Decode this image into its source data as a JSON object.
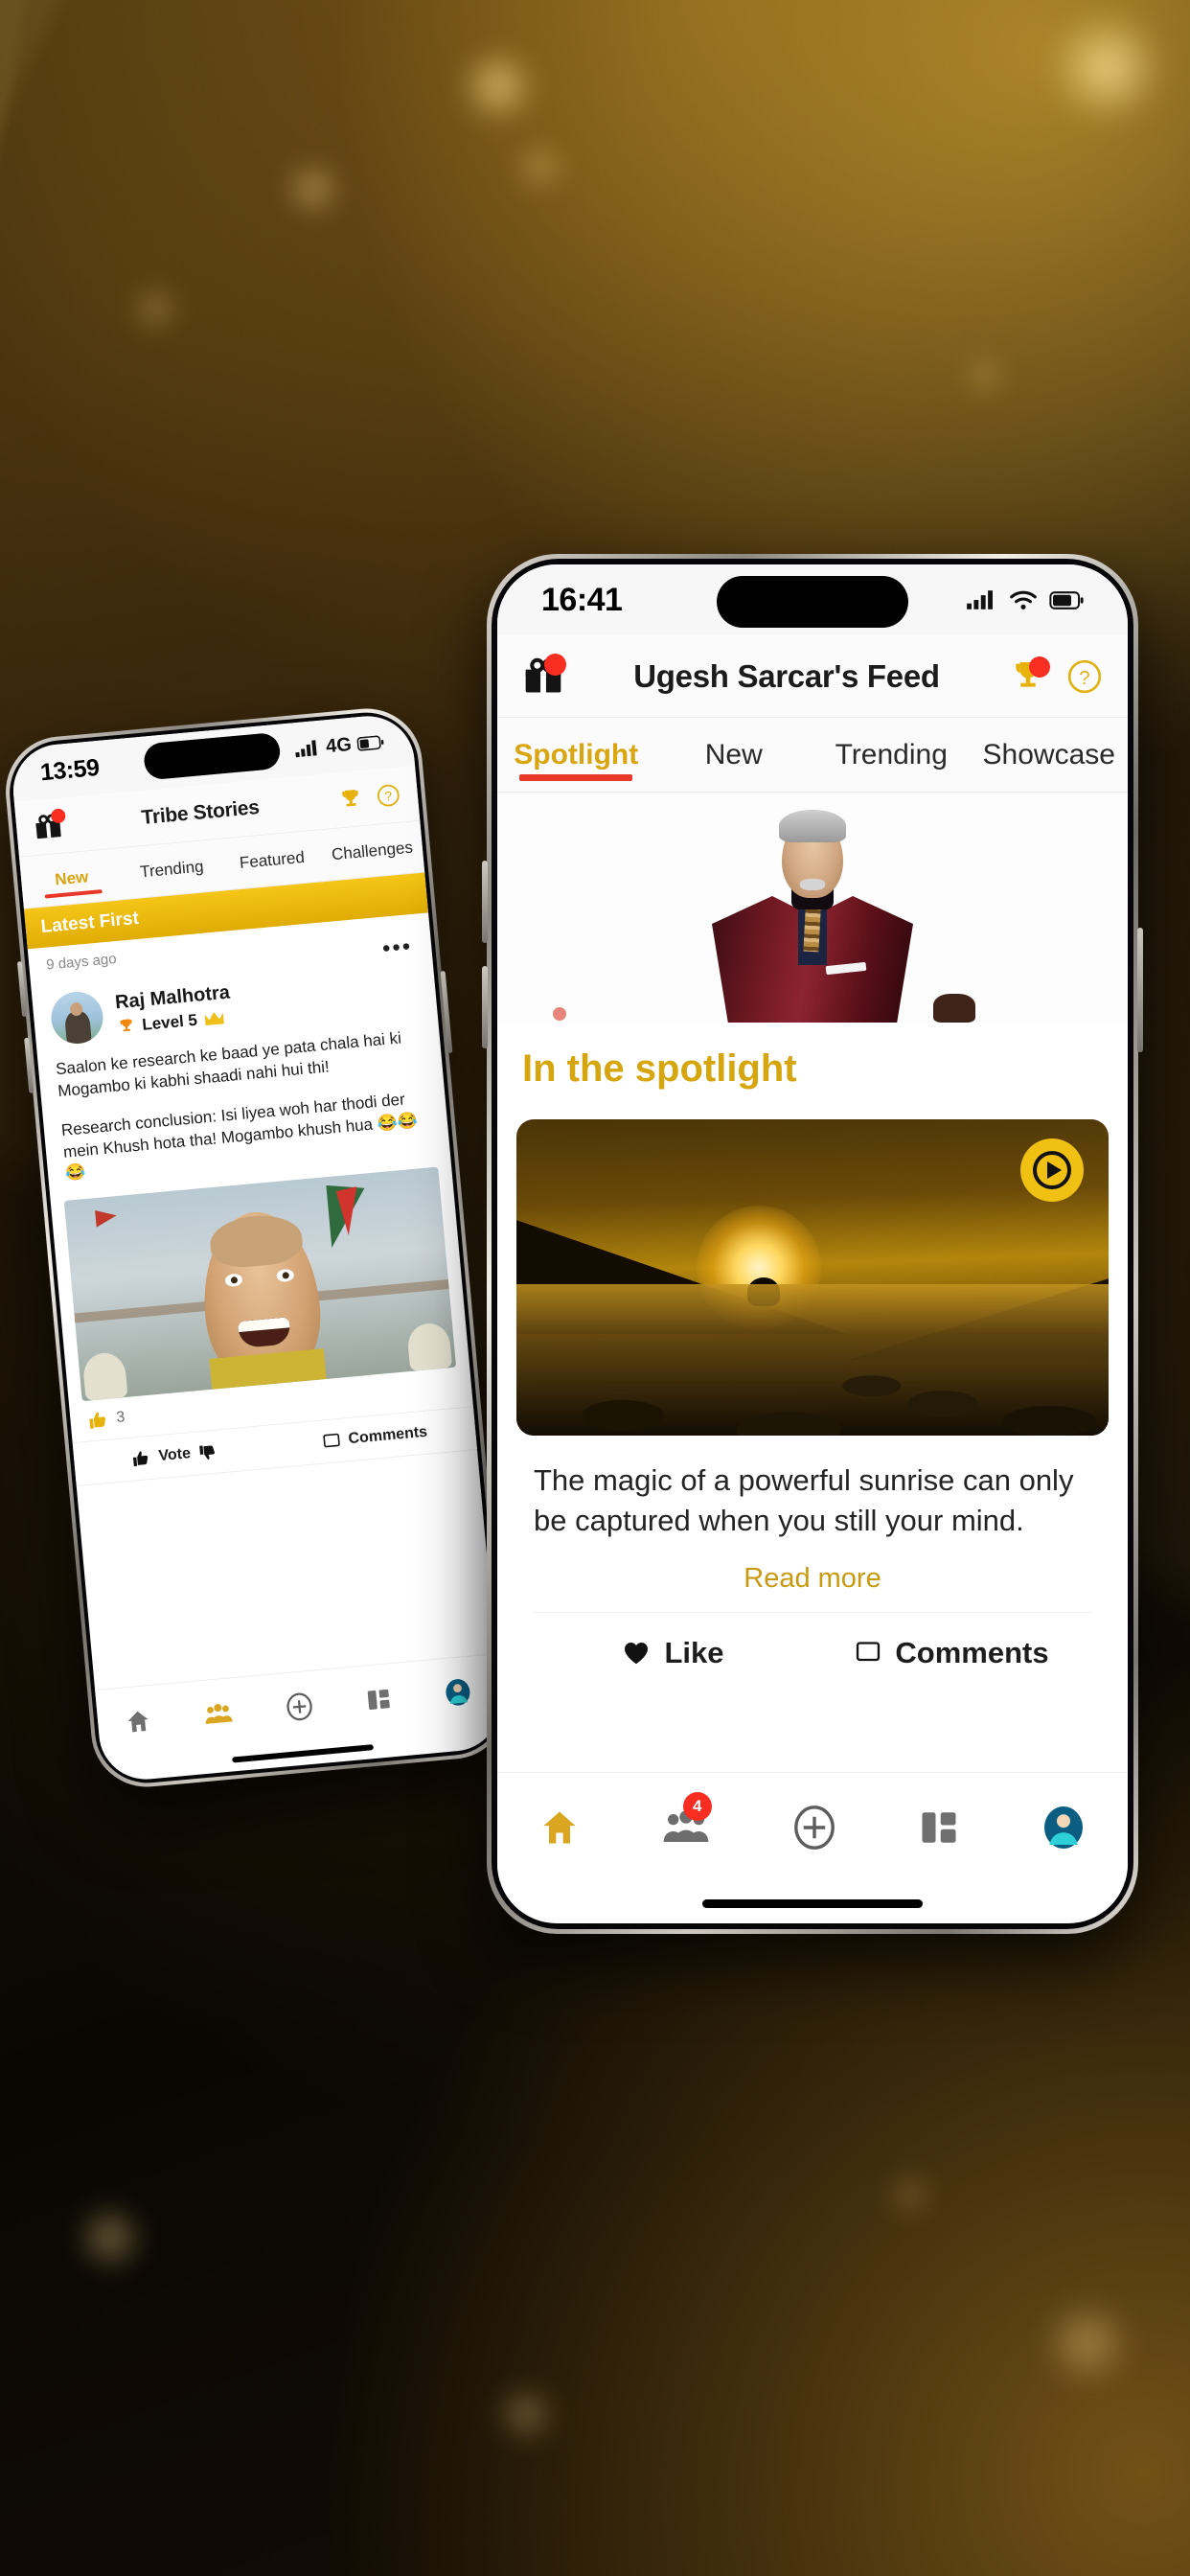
{
  "scene": {
    "description": "Two smartphones displaying a social community app over a dark golden bokeh background",
    "background_colors": [
      "#3a2a0c",
      "#231707",
      "#120c04",
      "#0a0703"
    ],
    "accent_gold": "#d9a510",
    "accent_red": "#e8382a",
    "badge_red": "#fa2d22"
  },
  "right_phone": {
    "status_bar": {
      "time": "16:41",
      "icons": [
        "cellular-signal-icon",
        "wifi-icon",
        "battery-icon"
      ]
    },
    "app_bar": {
      "gift_icon": "gift-icon",
      "gift_badge": "",
      "title": "Ugesh Sarcar's Feed",
      "trophy_icon": "trophy-icon",
      "trophy_badge": "",
      "help_icon": "help-circle-icon"
    },
    "tabs": [
      {
        "label": "Spotlight",
        "active": true
      },
      {
        "label": "New",
        "active": false
      },
      {
        "label": "Trending",
        "active": false
      },
      {
        "label": "Showcase",
        "active": false
      }
    ],
    "spotlight": {
      "hero_alt": "man-in-maroon-bandhgala-portrait",
      "section_title": "In the spotlight"
    },
    "post": {
      "media_alt": "golden-sunset-over-rocky-river",
      "play_icon": "play-circle-icon",
      "text": "The magic of a powerful sunrise can only be captured when you still your mind.",
      "read_more": "Read more",
      "actions": [
        {
          "label": "Like",
          "icon": "heart-icon"
        },
        {
          "label": "Comments",
          "icon": "comment-icon"
        }
      ]
    },
    "bottom_nav": [
      {
        "name": "home",
        "icon": "home-icon",
        "active": true,
        "badge": ""
      },
      {
        "name": "groups",
        "icon": "people-group-icon",
        "active": false,
        "badge": "4"
      },
      {
        "name": "create",
        "icon": "plus-circle-icon",
        "active": false,
        "badge": ""
      },
      {
        "name": "dashboard",
        "icon": "grid-layout-icon",
        "active": false,
        "badge": ""
      },
      {
        "name": "profile",
        "icon": "avatar-icon",
        "active": false,
        "badge": ""
      }
    ]
  },
  "left_phone": {
    "status_bar": {
      "time": "13:59",
      "network": "4G",
      "icons": [
        "cellular-signal-icon",
        "battery-icon"
      ]
    },
    "app_bar": {
      "gift_icon": "gift-icon",
      "title": "Tribe Stories",
      "trophy_icon": "trophy-icon",
      "help_icon": "help-circle-icon"
    },
    "tabs": [
      {
        "label": "New",
        "active": true
      },
      {
        "label": "Trending",
        "active": false
      },
      {
        "label": "Featured",
        "active": false
      },
      {
        "label": "Challenges",
        "active": false
      }
    ],
    "sort_bar": {
      "label": "Latest First"
    },
    "post": {
      "timestamp": "9 days ago",
      "more_icon": "more-options-icon",
      "author": "Raj Malhotra",
      "level": "Level 5",
      "level_icon": "trophy-icon",
      "crown_icon": "crown-icon",
      "body_line1": "Saalon ke research ke baad ye pata chala hai ki Mogambo ki kabhi shaadi nahi hui thi!",
      "body_line2": "Research conclusion: Isi liyea woh har thodi der mein Khush hota tha! Mogambo khush hua 😂😂😂",
      "media_alt": "mogambo-laughing-meme-still",
      "like_count": "3",
      "like_icon": "thumbs-up-icon",
      "actions": {
        "vote_label": "Vote",
        "vote_up_icon": "thumbs-up-icon",
        "vote_down_icon": "thumbs-down-icon",
        "comments_label": "Comments",
        "comments_icon": "comment-icon"
      }
    },
    "bottom_nav": [
      {
        "name": "home",
        "icon": "home-icon",
        "active": false
      },
      {
        "name": "groups",
        "icon": "people-group-icon",
        "active": true
      },
      {
        "name": "create",
        "icon": "plus-circle-icon",
        "active": false
      },
      {
        "name": "dashboard",
        "icon": "grid-layout-icon",
        "active": false
      },
      {
        "name": "profile",
        "icon": "avatar-icon",
        "active": false
      }
    ]
  }
}
